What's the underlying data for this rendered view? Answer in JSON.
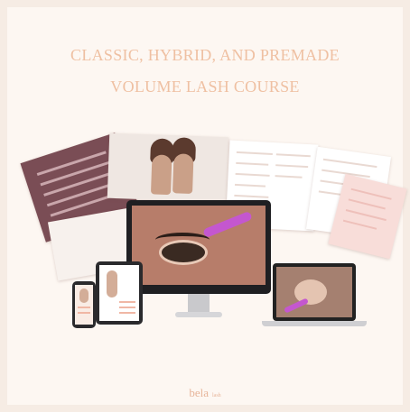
{
  "headline": {
    "line1": "CLASSIC, HYBRID, AND PREMADE",
    "line2": "VOLUME LASH COURSE"
  },
  "brand": {
    "name": "bela",
    "tag": "lash"
  },
  "colors": {
    "background": "#fdf7f2",
    "title": "#efc0a2",
    "accent_maroon": "#7a4d55",
    "brush_purple": "#c457cf"
  },
  "mockup_devices": [
    "monitor",
    "laptop",
    "tablet",
    "phone"
  ]
}
